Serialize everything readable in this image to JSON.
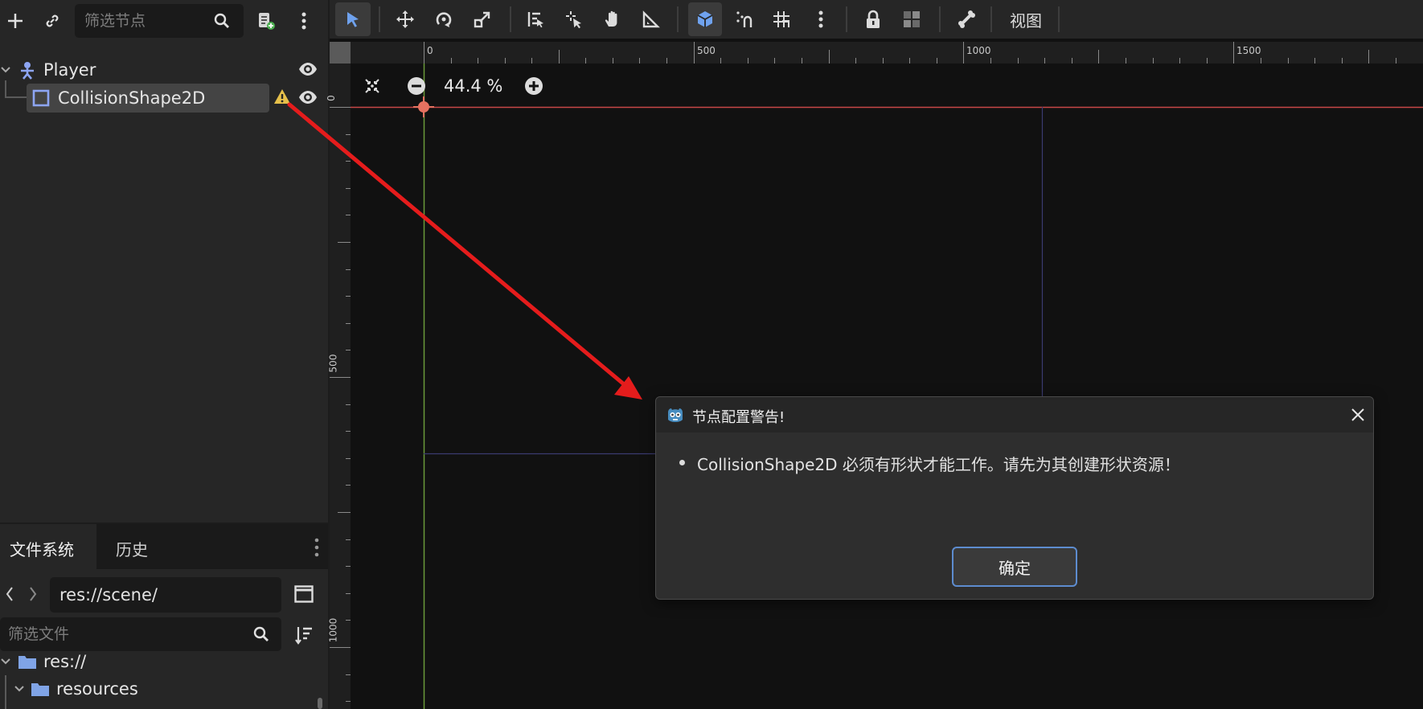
{
  "scene_dock": {
    "filter_placeholder": "筛选节点",
    "tree": [
      {
        "label": "Player",
        "icon": "character-body-2d-icon"
      },
      {
        "label": "CollisionShape2D",
        "icon": "collision-shape-2d-icon",
        "warning": true
      }
    ]
  },
  "filesystem_dock": {
    "tabs": [
      "文件系统",
      "历史"
    ],
    "active_tab": 0,
    "path": "res://scene/",
    "filter_placeholder": "筛选文件",
    "tree": [
      {
        "label": "res://"
      },
      {
        "label": "resources"
      }
    ]
  },
  "toolbar": {
    "view_menu_label": "视图"
  },
  "viewport": {
    "zoom_label": "44.4 %",
    "ruler_h_labels": [
      "0",
      "500",
      "1000",
      "1500"
    ],
    "ruler_v_labels": [
      "0",
      "500",
      "1000"
    ]
  },
  "dialog": {
    "title": "节点配置警告!",
    "message": "CollisionShape2D 必须有形状才能工作。请先为其创建形状资源！",
    "ok_label": "确定"
  },
  "colors": {
    "accent": "#5d8ccf",
    "annotation_arrow": "#e51c1c",
    "warning": "#e6c04a",
    "origin_x_axis": "#c84848",
    "origin_y_axis": "#6a9a3a"
  }
}
